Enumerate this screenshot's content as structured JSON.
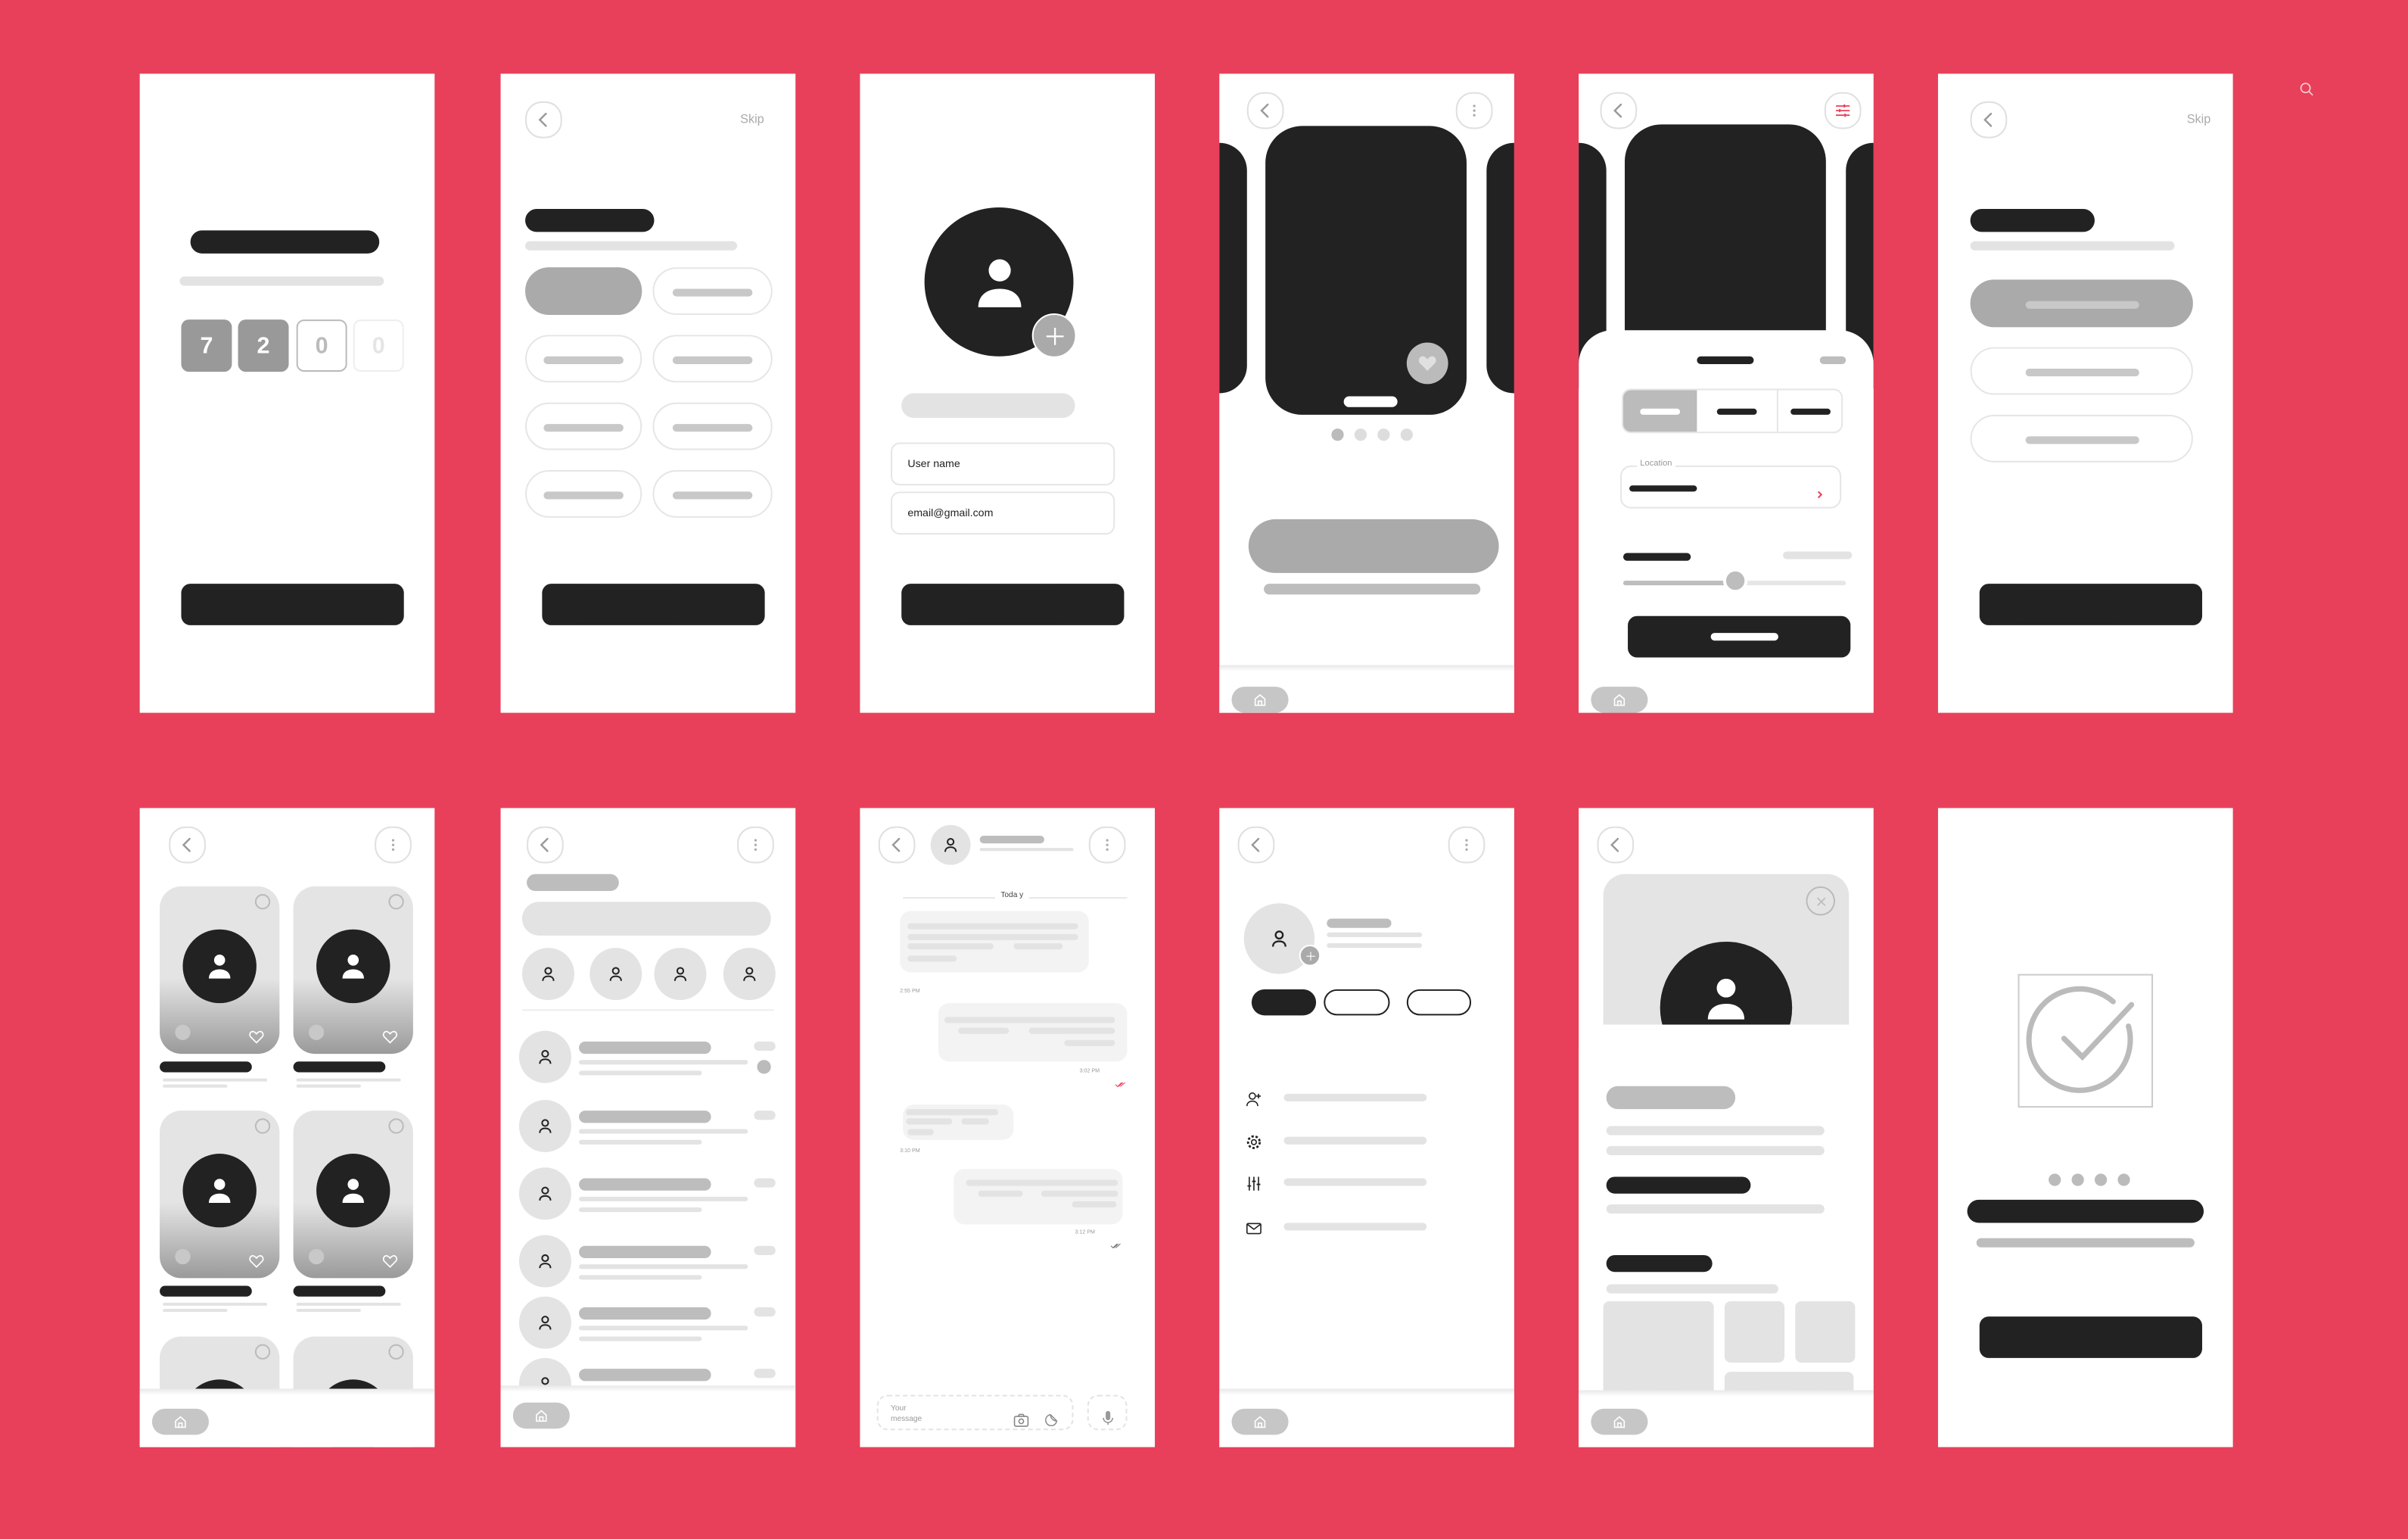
{
  "theme": {
    "background": "#E8405A",
    "dark": "#222222",
    "accent": "#E8405A",
    "gray": "#AAAAAA"
  },
  "top_icon": "search-icon",
  "screens": {
    "verify": {
      "code_digits": [
        "7",
        "2",
        "0",
        "0"
      ]
    },
    "interests": {
      "skip": "Skip"
    },
    "profile_setup": {
      "username_placeholder": "User name",
      "email_value": "email@gmail.com"
    },
    "swipe": {
      "carousel_pages": 4,
      "active_page": 1
    },
    "filters": {
      "location_label": "Location",
      "slider_value_percent": 50
    },
    "choice": {
      "skip": "Skip"
    },
    "chat": {
      "date_label": "Toda y",
      "times": [
        "2:55 PM",
        "3:02 PM",
        "3:10 PM",
        "3:12 PM"
      ],
      "input_placeholder": "Your message"
    },
    "success": {
      "carousel_pages": 4
    }
  }
}
